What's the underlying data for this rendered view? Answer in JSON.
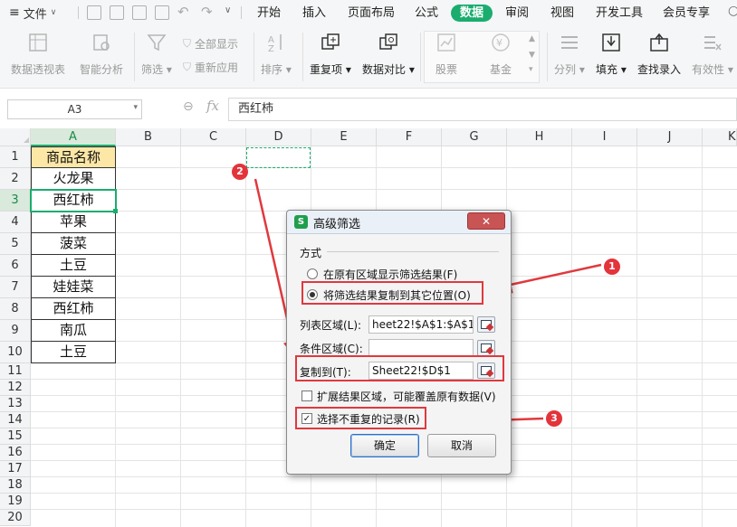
{
  "menubar": {
    "file_label": "文件",
    "tabs": [
      "开始",
      "插入",
      "页面布局",
      "公式",
      "数据",
      "审阅",
      "视图",
      "开发工具",
      "会员专享"
    ],
    "active_tab": "数据"
  },
  "ribbon": {
    "pivot_label": "数据透视表",
    "smart_label": "智能分析",
    "filter_label": "筛选",
    "show_all_label": "全部显示",
    "reapply_label": "重新应用",
    "sort_label": "排序",
    "duplicate_label": "重复项",
    "compare_label": "数据对比",
    "stocks_label": "股票",
    "fund_label": "基金",
    "split_label": "分列",
    "fill_label": "填充",
    "lookup_label": "查找录入",
    "validity_label": "有效性"
  },
  "formula_bar": {
    "name_box": "A3",
    "fx_label": "fx",
    "formula_value": "西红柿"
  },
  "sheet": {
    "columns": [
      "A",
      "B",
      "C",
      "D",
      "E",
      "F",
      "G",
      "H",
      "I",
      "J",
      "K"
    ],
    "rows": [
      "1",
      "2",
      "3",
      "4",
      "5",
      "6",
      "7",
      "8",
      "9",
      "10",
      "11",
      "12",
      "13",
      "14",
      "15",
      "16",
      "17",
      "18",
      "19",
      "20"
    ],
    "colA": [
      "商品名称",
      "火龙果",
      "西红柿",
      "苹果",
      "菠菜",
      "土豆",
      "娃娃菜",
      "西红柿",
      "南瓜",
      "土豆"
    ],
    "active_cell": "A3"
  },
  "dialog": {
    "title": "高级筛选",
    "close_label": "✕",
    "method_label": "方式",
    "option1": "在原有区域显示筛选结果(F)",
    "option2": "将筛选结果复制到其它位置(O)",
    "list_range_label": "列表区域(L):",
    "list_range_value": "heet22!$A$1:$A$10",
    "criteria_label": "条件区域(C):",
    "criteria_value": "",
    "copy_to_label": "复制到(T):",
    "copy_to_value": "Sheet22!$D$1",
    "expand_label": "扩展结果区域，可能覆盖原有数据(V)",
    "unique_label": "选择不重复的记录(R)",
    "ok_label": "确定",
    "cancel_label": "取消"
  },
  "annotations": {
    "badge1": "1",
    "badge2": "2",
    "badge3": "3",
    "color": "#e0393e"
  },
  "colors": {
    "accent": "#1aad6e",
    "header_fill": "#fde7a6"
  }
}
